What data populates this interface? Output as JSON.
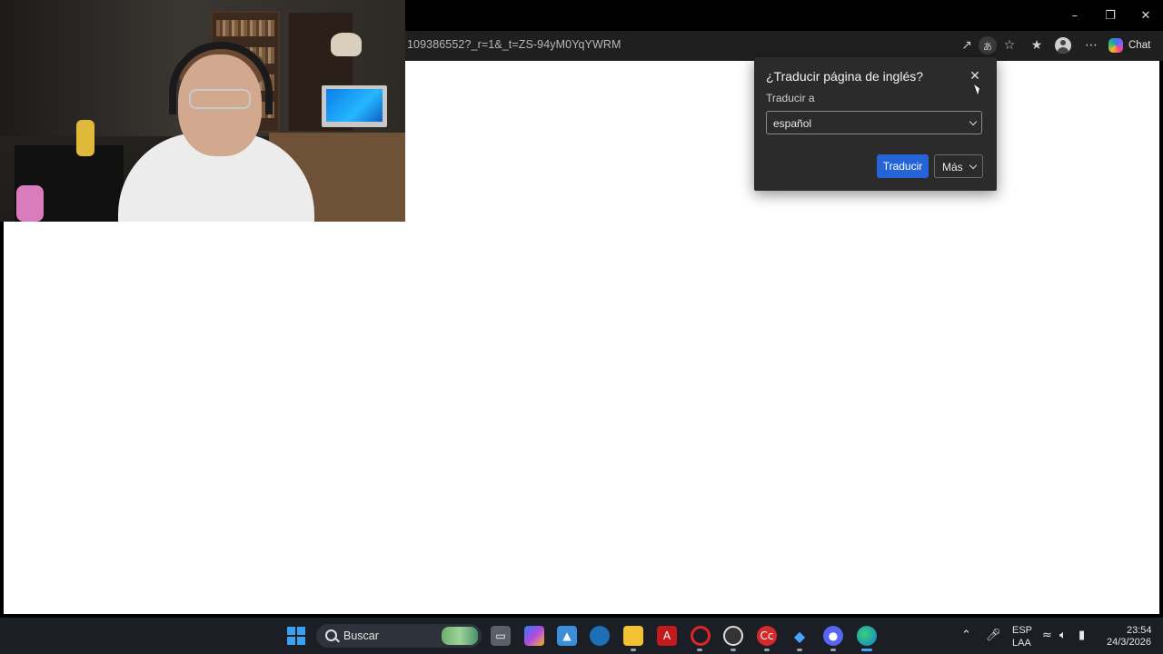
{
  "browser": {
    "url_text": "109386552?_r=1&_t=ZS-94yM0YqYWRM",
    "chat_label": "Chat"
  },
  "translate_popup": {
    "title": "¿Traducir página de inglés?",
    "target_label": "Traducir a",
    "selected_language": "español",
    "translate_button": "Traducir",
    "more_button": "Más"
  },
  "taskbar": {
    "search_placeholder": "Buscar",
    "language_line1": "ESP",
    "language_line2": "LAA",
    "time": "23:54",
    "date": "24/3/2026",
    "apps": [
      "windows-start",
      "search",
      "task-view",
      "copilot",
      "photos",
      "edge-blue",
      "file-explorer",
      "acrobat",
      "opera",
      "obs",
      "creative-cloud",
      "sourcetree",
      "discord",
      "edge"
    ]
  },
  "colors": {
    "accent": "#2464d6",
    "popup_bg": "#2b2b2b",
    "taskbar_bg": "#1b1e24"
  }
}
